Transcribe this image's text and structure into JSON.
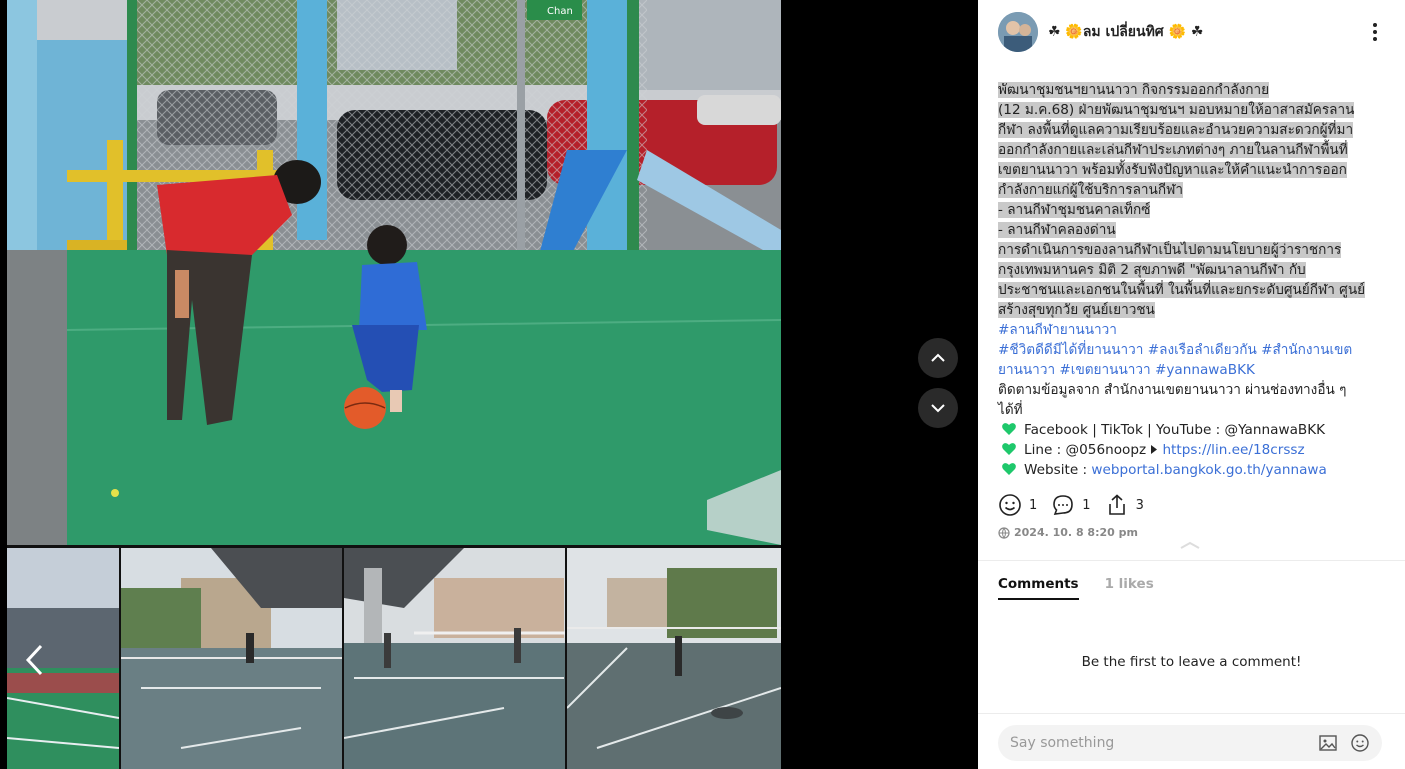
{
  "post": {
    "author": "☘ ᷄ล꒳ม เปลี่ยนทิศ ᷄ ☘",
    "author_display": "☘ 🌼ลม เปลี่ยนทิศ 🌼 ☘",
    "body_lines": [
      "พัฒนาชุมชนฯยานนาวา กิจกรรมออกกำลังกาย",
      " (12 ม.ค.68)  ฝ่ายพัฒนาชุมชนฯ มอบหมายให้อาสาสมัครลาน",
      "กีฬา ลงพื้นที่ดูแลความเรียบร้อยและอำนวยความสะดวกผู้ที่มา",
      "ออกกำลังกายและเล่นกีฬาประเภทต่างๆ ภายในลานกีฬาพื้นที่",
      "เขตยานนาวา พร้อมทั้งรับฟังปัญหาและให้คำแนะนำการออก",
      "กำลังกายแก่ผู้ใช้บริการลานกีฬา",
      "- ลานกีฬาชุมชนคาลเท็กซ์",
      "- ลานกีฬาคลองด่าน",
      "   การดำเนินการของลานกีฬาเป็นไปตามนโยบายผู้ว่าราชการ",
      "กรุงเทพมหานคร  มิติ 2 สุขภาพดี  \"พัฒนาลานกีฬา กับ",
      "ประชาชนและเอกชนในพื้นที่ ในพื้นที่และยกระดับศูนย์กีฬา ศูนย์",
      "สร้างสุขทุกวัย ศูนย์เยาวชน"
    ],
    "hashtags_1": "#ลานกีฬายานนาวา",
    "hashtags_2": "#ชีวิตดีดีมีได้ที่ยานนาวา #ลงเรือลำเดียวกัน #สำนักงานเขต",
    "hashtags_3": "ยานนาวา #เขตยานนาวา #yannawaBKK",
    "follow_line_1": "ติดตามข้อมูลจาก สำนักงานเขตยานนาวา ผ่านช่องทางอื่น ๆ",
    "follow_line_2": "ได้ที่",
    "channel_1": "Facebook | TikTok | YouTube : @YannawaBKK",
    "channel_2_text": "Line : @056noopz ",
    "channel_2_link": "https://lin.ee/18crssz",
    "channel_3_text": "Website : ",
    "channel_3_link": "webportal.bangkok.go.th/yannawa",
    "reaction_count": "1",
    "comment_count": "1",
    "share_count": "3",
    "date": "2024. 10. 8 8:20 pm"
  },
  "tabs": {
    "comments": "Comments",
    "likes": "1 likes"
  },
  "empty_comments": "Be the first to leave a comment!",
  "composer": {
    "placeholder": "Say something"
  },
  "photo": {
    "street_sign": "Chan"
  },
  "icons": {
    "heart": "green-heart-icon",
    "reaction": "smiley-icon",
    "comment": "comment-bubble-icon",
    "share": "share-icon",
    "globe": "globe-icon",
    "image": "image-icon",
    "emoji": "emoji-icon"
  },
  "colors": {
    "heart": "#1ec86b",
    "link": "#3b6fd6",
    "highlight": "#c9c9c9",
    "court_green": "#2f9a6a"
  }
}
